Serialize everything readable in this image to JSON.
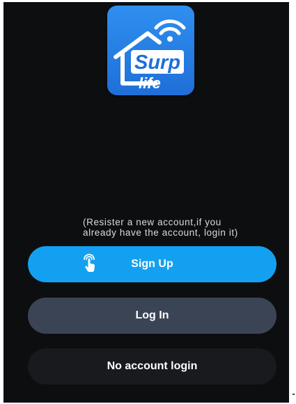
{
  "logo": {
    "text_top": "Surp",
    "text_bottom": "life"
  },
  "hint": {
    "line1": "(Resister a new account,if you",
    "line2": "already have the account, login it)"
  },
  "buttons": {
    "signup_label": "Sign Up",
    "login_label": "Log In",
    "no_account_label": "No account login"
  },
  "colors": {
    "background": "#0d0e10",
    "signup": "#14a0f0",
    "login": "#3a4454",
    "logo_blue": "#2f8ff0"
  }
}
